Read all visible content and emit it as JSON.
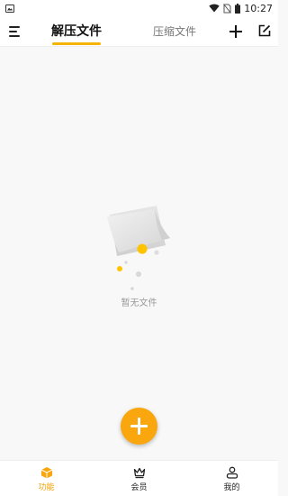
{
  "status_bar": {
    "time": "10:27",
    "icons": [
      "image-icon",
      "wifi-icon",
      "no-sim-icon",
      "battery-icon"
    ]
  },
  "header": {
    "tabs": [
      {
        "label": "解压文件",
        "active": true
      },
      {
        "label": "压缩文件",
        "active": false
      }
    ],
    "icons": [
      "menu-icon",
      "plus-icon",
      "edit-icon"
    ],
    "accent_color": "#f5b400"
  },
  "empty_state": {
    "message": "暂无文件"
  },
  "fab": {
    "icon": "plus-icon",
    "color": "#f9a60f"
  },
  "bottom_nav": {
    "items": [
      {
        "label": "功能",
        "icon": "box-icon",
        "active": true
      },
      {
        "label": "会员",
        "icon": "crown-icon",
        "active": false
      },
      {
        "label": "我的",
        "icon": "user-icon",
        "active": false
      }
    ],
    "active_color": "#f5a000"
  }
}
